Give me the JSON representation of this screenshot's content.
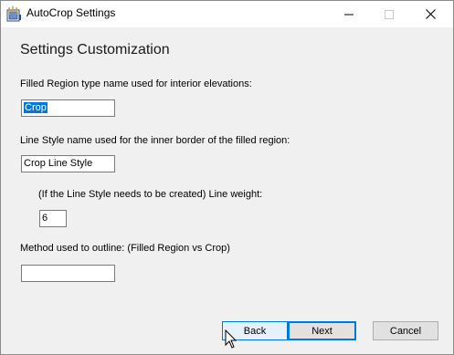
{
  "window": {
    "title": "AutoCrop Settings",
    "controls": {
      "minimize_icon": "minimize-icon",
      "maximize_icon": "maximize-icon",
      "close_icon": "close-icon"
    }
  },
  "form": {
    "heading": "Settings Customization",
    "filled_region": {
      "label": "Filled Region type name used for interior elevations:",
      "value": "Crop"
    },
    "line_style": {
      "label": "Line Style name used for the inner border of the filled region:",
      "value": "Crop Line Style"
    },
    "line_weight": {
      "label": "(If the Line Style needs to be created) Line weight:",
      "value": "6"
    },
    "method": {
      "label": "Method used to outline: (Filled Region vs Crop)",
      "value": ""
    }
  },
  "buttons": {
    "back": "Back",
    "next": "Next",
    "cancel": "Cancel"
  },
  "colors": {
    "accent": "#0078d7",
    "window_bg": "#f0f0f0",
    "titlebar_bg": "#ffffff"
  }
}
